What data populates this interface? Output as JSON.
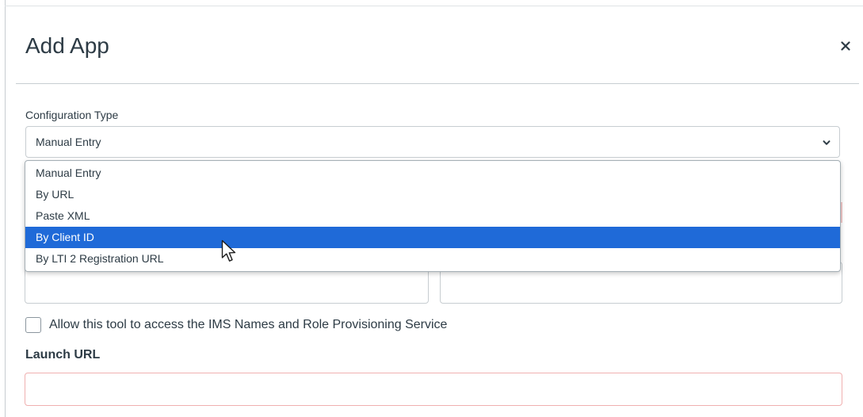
{
  "modal": {
    "title": "Add App",
    "close_icon": "close-icon"
  },
  "config_type": {
    "label": "Configuration Type",
    "selected_value": "Manual Entry",
    "options": [
      "Manual Entry",
      "By URL",
      "Paste XML",
      "By Client ID",
      "By LTI 2 Registration URL"
    ],
    "highlighted_option": "By Client ID"
  },
  "ims_checkbox": {
    "label": "Allow this tool to access the IMS Names and Role Provisioning Service",
    "checked": false
  },
  "launch_url": {
    "label": "Launch URL",
    "value": ""
  },
  "colors": {
    "highlight": "#1f6ad8",
    "text": "#2d3b45",
    "border": "#c7cdd1",
    "error_border": "#f0b0b0"
  }
}
